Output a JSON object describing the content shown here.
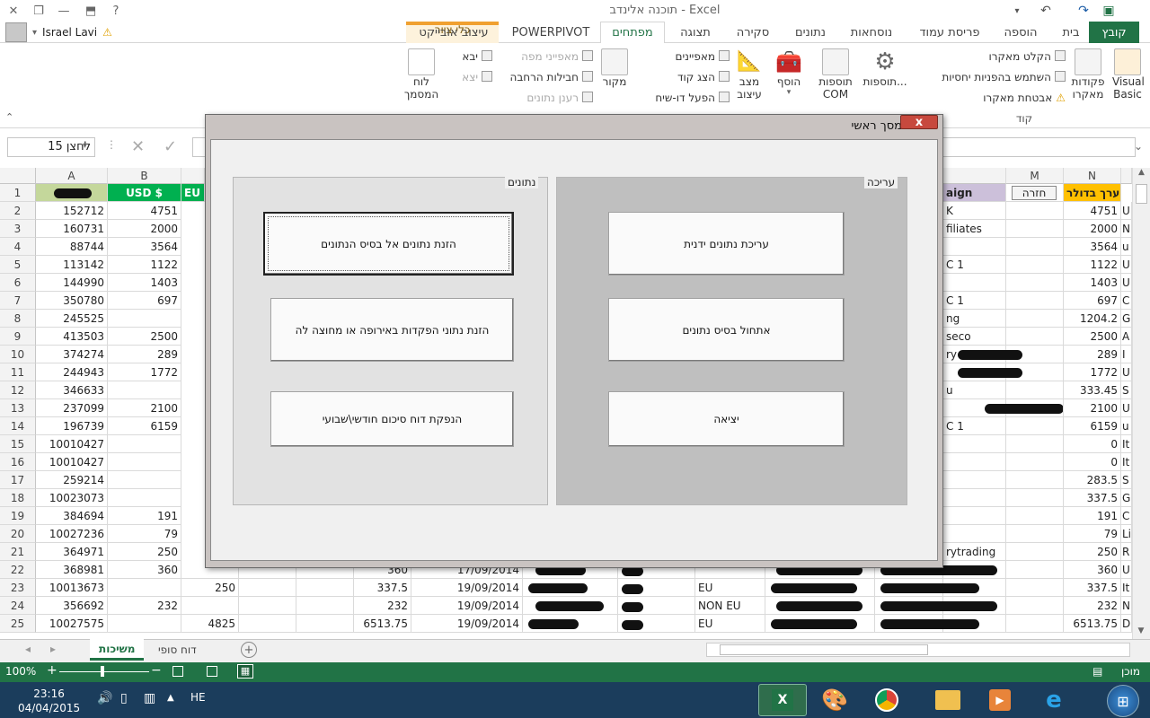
{
  "window": {
    "title": "תוכנה אלינדב - Excel",
    "help": "?"
  },
  "user": {
    "name": "Israel Lavi"
  },
  "tabs": [
    {
      "label": "קובץ"
    },
    {
      "label": "בית"
    },
    {
      "label": "הוספה"
    },
    {
      "label": "פריסת עמוד"
    },
    {
      "label": "נוסחאות"
    },
    {
      "label": "נתונים"
    },
    {
      "label": "סקירה"
    },
    {
      "label": "תצוגה"
    },
    {
      "label": "מפתחים"
    },
    {
      "label": "POWERPIVOT"
    },
    {
      "label": "עיצוב אובייקט"
    }
  ],
  "context_group": {
    "label": "כלי ציור"
  },
  "ribbon": {
    "visual_basic": "Visual Basic",
    "macros": "פקודות מאקרו",
    "record_macro": "הקלט מאקרו",
    "relative_refs": "השתמש בהפניות יחסיות",
    "macro_security": "אבטחת מאקרו",
    "group_code": "קוד",
    "addins": "תוספות...",
    "com_addins": "תוספות COM",
    "insert": "הוסף",
    "design_mode": "מצב עיצוב",
    "properties": "מאפיינים",
    "view_code": "הצג קוד",
    "run_dialog": "הפעל דו-שיח",
    "source": "מקור",
    "map_props": "מאפייני מפה",
    "expansion_packs": "חבילות הרחבה",
    "refresh_data": "רענן נתונים",
    "import": "יבא",
    "export": "יצא",
    "document_panel": "לוח המסמך"
  },
  "formula_bar": {
    "name_box": "לחצן 15"
  },
  "columns": {
    "left": [
      "A",
      "B"
    ],
    "right": [
      "M",
      "N"
    ]
  },
  "header_row": {
    "a": "",
    "b": "USD $",
    "c_partial": "EU",
    "campaign": "aign",
    "back_button": "חזרה",
    "n": "ערך בדולר"
  },
  "rows": [
    {
      "r": "1"
    },
    {
      "r": "2",
      "a": "152712",
      "b": "4751",
      "camp": "K",
      "n": "4751",
      "o": "U"
    },
    {
      "r": "3",
      "a": "160731",
      "b": "2000",
      "camp": "filiates",
      "n": "2000",
      "o": "N"
    },
    {
      "r": "4",
      "a": "88744",
      "b": "3564",
      "camp": "",
      "n": "3564",
      "o": "u"
    },
    {
      "r": "5",
      "a": "113142",
      "b": "1122",
      "camp": "C 1",
      "n": "1122",
      "o": "U"
    },
    {
      "r": "6",
      "a": "144990",
      "b": "1403",
      "camp": "",
      "n": "1403",
      "o": "U"
    },
    {
      "r": "7",
      "a": "350780",
      "b": "697",
      "camp": "C 1",
      "n": "697",
      "o": "C"
    },
    {
      "r": "8",
      "a": "245525",
      "b": "",
      "camp": "ng",
      "n": "1204.2",
      "o": "G"
    },
    {
      "r": "9",
      "a": "413503",
      "b": "2500",
      "camp": "seco",
      "n": "2500",
      "o": "A"
    },
    {
      "r": "10",
      "a": "374274",
      "b": "289",
      "camp": "ry",
      "n": "289",
      "o": "I"
    },
    {
      "r": "11",
      "a": "244943",
      "b": "1772",
      "camp": "",
      "n": "1772",
      "o": "U"
    },
    {
      "r": "12",
      "a": "346633",
      "b": "",
      "camp": "u",
      "n": "333.45",
      "o": "S"
    },
    {
      "r": "13",
      "a": "237099",
      "b": "2100",
      "camp": "",
      "n": "2100",
      "o": "U"
    },
    {
      "r": "14",
      "a": "196739",
      "b": "6159",
      "camp": "C 1",
      "n": "6159",
      "o": "u"
    },
    {
      "r": "15",
      "a": "10010427",
      "b": "",
      "camp": "",
      "n": "0",
      "o": "It"
    },
    {
      "r": "16",
      "a": "10010427",
      "b": "",
      "camp": "",
      "n": "0",
      "o": "It"
    },
    {
      "r": "17",
      "a": "259214",
      "b": "",
      "camp": "",
      "n": "283.5",
      "o": "S"
    },
    {
      "r": "18",
      "a": "10023073",
      "b": "",
      "camp": "",
      "n": "337.5",
      "o": "G"
    },
    {
      "r": "19",
      "a": "384694",
      "b": "191",
      "camp": "",
      "n": "191",
      "o": "C"
    },
    {
      "r": "20",
      "a": "10027236",
      "b": "79",
      "camp": "",
      "n": "79",
      "o": "Li"
    },
    {
      "r": "21",
      "a": "364971",
      "b": "250",
      "camp": "rytrading",
      "n": "250",
      "o": "R"
    },
    {
      "r": "22",
      "a": "368981",
      "b": "360",
      "c": "",
      "e": "360",
      "f": "17/09/2014",
      "h": "",
      "camp": "",
      "n": "360",
      "o": "U"
    },
    {
      "r": "23",
      "a": "10013673",
      "b": "",
      "c": "250",
      "e": "337.5",
      "f": "19/09/2014",
      "h": "EU",
      "camp": "",
      "n": "337.5",
      "o": "It"
    },
    {
      "r": "24",
      "a": "356692",
      "b": "232",
      "c": "",
      "e": "232",
      "f": "19/09/2014",
      "h": "NON EU",
      "camp": "",
      "n": "232",
      "o": "N"
    },
    {
      "r": "25",
      "a": "10027575",
      "b": "",
      "c": "4825",
      "e": "6513.75",
      "f": "19/09/2014",
      "h": "EU",
      "camp": "",
      "n": "6513.75",
      "o": "D"
    }
  ],
  "sheets": [
    {
      "label": "משיכות",
      "active": true
    },
    {
      "label": "דוח סופי",
      "active": false
    }
  ],
  "status": {
    "ready": "מוכן",
    "zoom": "100%"
  },
  "taskbar": {
    "time": "23:16",
    "date": "04/04/2015",
    "lang": "HE"
  },
  "dialog": {
    "title": "מסך ראשי",
    "close": "x",
    "frame_edit": {
      "caption": "עריכה",
      "buttons": [
        "עריכת נתונים ידנית",
        "אתחול בסיס נתונים",
        "יציאה"
      ]
    },
    "frame_data": {
      "caption": "נתונים",
      "buttons": [
        "הזנת נתונים אל בסיס הנתונים",
        "הזנת נתוני הפקדות באירופה או מחוצה לה",
        "הנפקת דוח סיכום חודשי\\שבועי"
      ]
    }
  },
  "colors": {
    "excel_green": "#217346",
    "header_green": "#00b050",
    "header_light_green": "#c4d79b",
    "campaign_purple": "#ccc0da",
    "n_orange": "#ffc000"
  }
}
